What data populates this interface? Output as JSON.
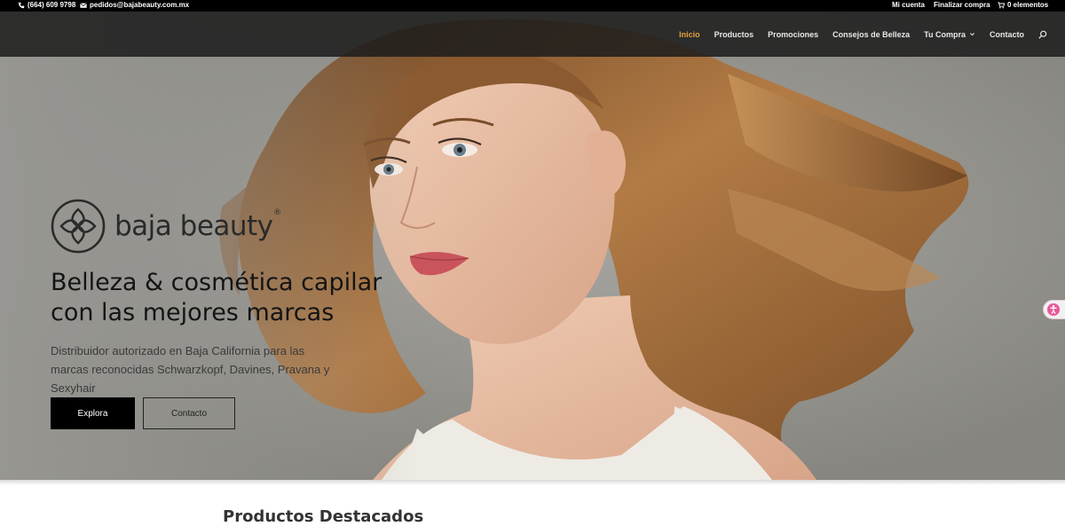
{
  "topbar": {
    "phone": "(664) 609 9798",
    "email": "pedidos@bajabeauty.com.mx",
    "account": "Mi cuenta",
    "checkout": "Finalizar compra",
    "cart": "0 elementos"
  },
  "nav": {
    "items": [
      {
        "label": "Inicio",
        "active": true
      },
      {
        "label": "Productos"
      },
      {
        "label": "Promociones"
      },
      {
        "label": "Consejos de Belleza"
      },
      {
        "label": "Tu Compra",
        "has_dropdown": true
      },
      {
        "label": "Contacto"
      }
    ],
    "search_icon": "search-icon",
    "active_color": "#e2a23a"
  },
  "hero": {
    "brand": "baja beauty",
    "headline_line1": "Belleza & cosmética capilar",
    "headline_line2": "con las mejores marcas",
    "subtext": "Distribuidor autorizado en Baja California para las marcas reconocidas Schwarzkopf, Davines, Pravana y Sexyhair",
    "explore_label": "Explora",
    "contact_label": "Contacto"
  },
  "section": {
    "title": "Productos Destacados"
  }
}
